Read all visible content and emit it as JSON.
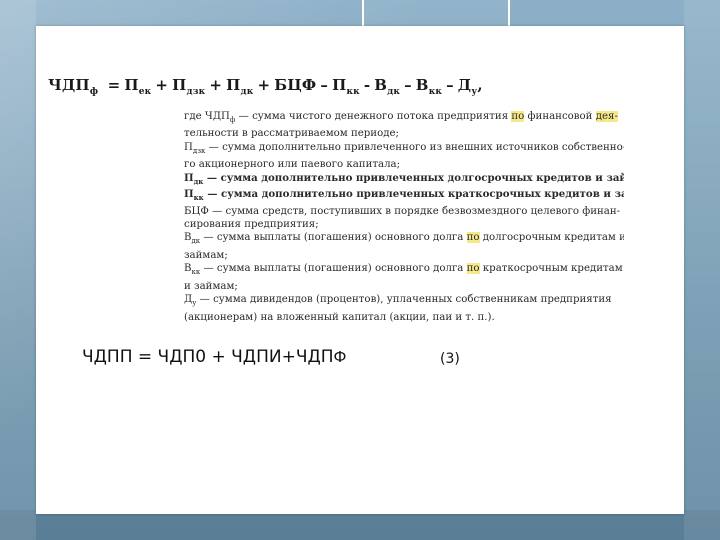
{
  "formula_main": {
    "lhs": "ЧДП",
    "lhs_sub": "ф",
    "terms": [
      {
        "sign": "=",
        "base": "П",
        "sub": "ек"
      },
      {
        "sign": "+",
        "base": "П",
        "sub": "дзк"
      },
      {
        "sign": "+",
        "base": "П",
        "sub": "дк"
      },
      {
        "sign": "+",
        "base": "БЦФ",
        "sub": ""
      },
      {
        "sign": "–",
        "base": "П",
        "sub": "кк"
      },
      {
        "sign": "-",
        "base": "В",
        "sub": "дк"
      },
      {
        "sign": "–",
        "base": "В",
        "sub": "кк"
      },
      {
        "sign": "–",
        "base": "Д",
        "sub": "у"
      }
    ],
    "tail": ","
  },
  "legend": {
    "lines": [
      {
        "pre": "где ЧДП",
        "sub": "ф",
        "text": " — сумма чистого денежного потока предприятия ",
        "hl1": "по",
        "mid": " финансовой ",
        "hl2": "дея-",
        "post": "",
        "bold": false
      },
      {
        "pre": "",
        "sub": "",
        "text": "тельности в рассматриваемом периоде;",
        "hl1": "",
        "mid": "",
        "hl2": "",
        "post": "",
        "bold": false
      },
      {
        "pre": "П",
        "sub": "дзк",
        "text": " — сумма дополнительно привлеченного из внешних источников собственно-",
        "hl1": "",
        "mid": "",
        "hl2": "",
        "post": "",
        "bold": false
      },
      {
        "pre": "",
        "sub": "",
        "text": "го акционерного или паевого капитала;",
        "hl1": "",
        "mid": "",
        "hl2": "",
        "post": "",
        "bold": false
      },
      {
        "pre": "П",
        "sub": "дк",
        "text": " — сумма дополнительно привлеченных долгосрочных кредитов и займов;",
        "hl1": "",
        "mid": "",
        "hl2": "",
        "post": "",
        "bold": true
      },
      {
        "pre": "П",
        "sub": "кк",
        "text": " — сумма дополнительно привлеченных краткосрочных кредитов и займов;",
        "hl1": "",
        "mid": "",
        "hl2": "",
        "post": "",
        "bold": true
      },
      {
        "pre": "БЦФ",
        "sub": "",
        "text": " — сумма средств, поступивших в порядке безвозмездного целевого финан-",
        "hl1": "",
        "mid": "",
        "hl2": "",
        "post": "",
        "bold": false
      },
      {
        "pre": "",
        "sub": "",
        "text": "сирования предприятия;",
        "hl1": "",
        "mid": "",
        "hl2": "",
        "post": "",
        "bold": false
      },
      {
        "pre": "В",
        "sub": "дк",
        "text": " — сумма выплаты (погашения) основного долга ",
        "hl1": "по",
        "mid": " долгосрочным кредитам и",
        "hl2": "",
        "post": "",
        "bold": false
      },
      {
        "pre": "",
        "sub": "",
        "text": "займам;",
        "hl1": "",
        "mid": "",
        "hl2": "",
        "post": "",
        "bold": false
      },
      {
        "pre": "В",
        "sub": "кк",
        "text": " — сумма выплаты (погашения) основного долга ",
        "hl1": "по",
        "mid": " краткосрочным кредитам",
        "hl2": "",
        "post": "",
        "bold": false
      },
      {
        "pre": "",
        "sub": "",
        "text": "и займам;",
        "hl1": "",
        "mid": "",
        "hl2": "",
        "post": "",
        "bold": false
      },
      {
        "pre": "Д",
        "sub": "у",
        "text": " — сумма дивидендов (процентов), уплаченных собственникам предприятия",
        "hl1": "",
        "mid": "",
        "hl2": "",
        "post": "",
        "bold": false
      },
      {
        "pre": "",
        "sub": "",
        "text": "(акционерам) на вложенный капитал (акции, паи и т. п.).",
        "hl1": "",
        "mid": "",
        "hl2": "",
        "post": "",
        "bold": false
      }
    ]
  },
  "formula_bottom": {
    "text": "ЧДПП = ЧДП0 + ЧДПИ+ЧДП",
    "sub": "Ф",
    "number": "(3)"
  }
}
